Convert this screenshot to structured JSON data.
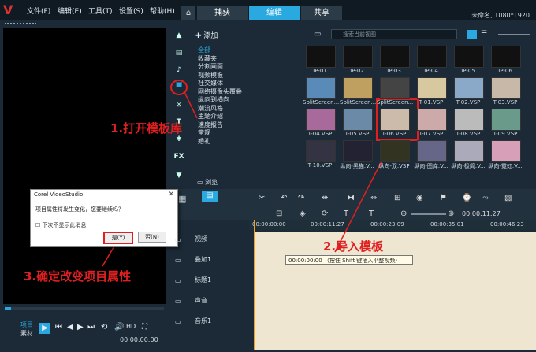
{
  "menu": [
    "文件(F)",
    "编辑(E)",
    "工具(T)",
    "设置(S)",
    "帮助(H)"
  ],
  "tabs": {
    "home": "⌂",
    "capture": "捕获",
    "edit": "编辑",
    "share": "共享"
  },
  "project": "未命名, 1080*1920",
  "library": {
    "add": "添加",
    "search_placeholder": "搜索当前视图",
    "browse": "浏览",
    "folders": [
      "全部",
      "收藏夹",
      "分割画面",
      "视频模板",
      "社交媒体",
      "网络摄像头覆叠",
      "纵向到横向",
      "潮流风格",
      "主题介绍",
      "速度报告",
      "常规",
      "婚礼"
    ],
    "items": [
      "IP-01",
      "IP-02",
      "IP-03",
      "IP-04",
      "IP-05",
      "IP-06",
      "SplitScreen...",
      "SplitScreen...",
      "SplitScreen...",
      "T-01.VSP",
      "T-02.VSP",
      "T-03.VSP",
      "T-04.VSP",
      "T-05.VSP",
      "T-06.VSP",
      "T-07.VSP",
      "T-08.VSP",
      "T-09.VSP",
      "T-10.VSP",
      "纵向-黑猫.V...",
      "纵向-双.VSP",
      "纵向-图库.V...",
      "纵向-极简.V...",
      "纵向-霓虹.V..."
    ]
  },
  "ruler": [
    "00:00:00:00",
    "00:00:11:27",
    "00:00:23:09",
    "00:00:35:01",
    "00:00:46:23"
  ],
  "tracks": [
    "视频",
    "叠加1",
    "标题1",
    "声音",
    "音乐1"
  ],
  "tooltip": "00:00:00:00 （按住 Shift 键插入平整视频）",
  "player": {
    "project": "项目",
    "clip": "素材",
    "hd": "HD",
    "timecode": "00 00:00:00"
  },
  "dialog": {
    "title": "Corel VideoStudio",
    "close": "✕",
    "message": "项目属性将发生变化，您要继续吗？",
    "checkbox": "下次不显示此消息",
    "yes": "是(Y)",
    "no": "否(N)"
  },
  "annotations": {
    "step1": "1.打开模板库",
    "step2": "2.导入模板",
    "step3": "3.确定改变项目属性"
  },
  "colors": {
    "accent": "#2aa8e0",
    "annotation": "#e02020",
    "timeline_bg": "#efe6d2"
  }
}
